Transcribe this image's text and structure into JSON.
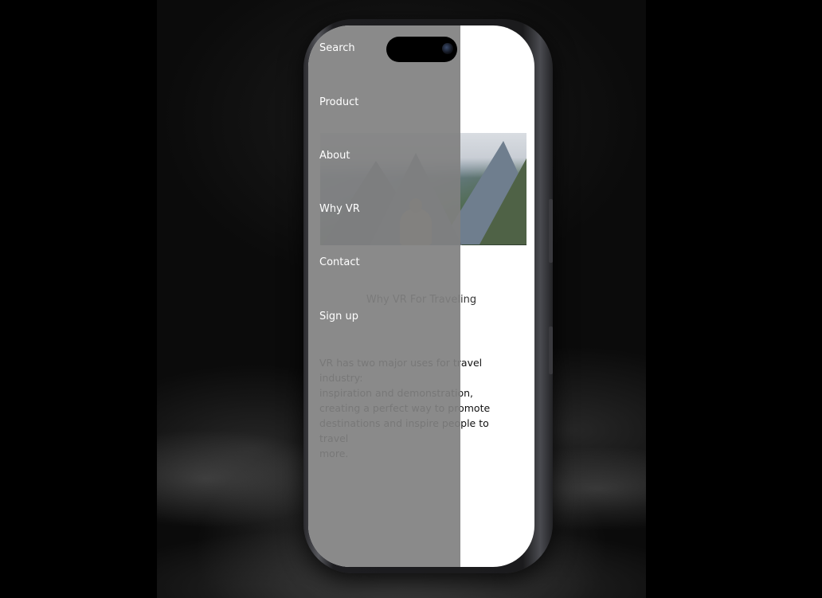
{
  "menu": {
    "items": [
      {
        "label": "Search"
      },
      {
        "label": "Product"
      },
      {
        "label": "About"
      },
      {
        "label": "Why VR"
      },
      {
        "label": "Contact"
      },
      {
        "label": "Sign up"
      }
    ]
  },
  "content": {
    "section_title": "Why VR For Traveling",
    "body_lines": [
      "VR has two major uses for travel industry:",
      "inspiration and demonstration,",
      "creating a perfect way to promote",
      "destinations and inspire people to travel",
      "more."
    ]
  },
  "colors": {
    "overlay": "#808080",
    "screen_background": "#ffffff",
    "menu_text": "#ffffff"
  }
}
